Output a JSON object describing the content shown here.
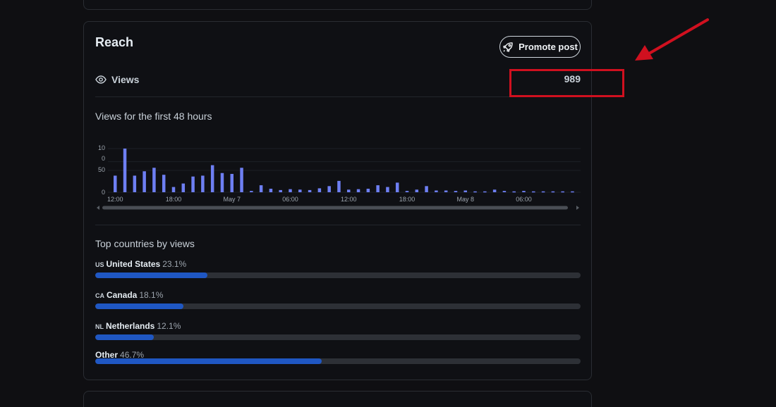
{
  "reach": {
    "title": "Reach",
    "promote_label": "Promote post",
    "views_label": "Views",
    "views_value": "989"
  },
  "chart_data": {
    "type": "bar",
    "title": "Views for the first 48 hours",
    "y_tick_labels": [
      "10\n0",
      "50",
      "0"
    ],
    "x_tick_labels": [
      "12:00",
      "18:00",
      "May 7",
      "06:00",
      "12:00",
      "18:00",
      "May 8",
      "06:00"
    ],
    "ylim": [
      0,
      100
    ],
    "values": [
      38,
      100,
      38,
      48,
      56,
      40,
      12,
      20,
      36,
      38,
      62,
      44,
      42,
      56,
      3,
      16,
      8,
      5,
      7,
      6,
      5,
      9,
      14,
      26,
      6,
      7,
      8,
      16,
      12,
      22,
      3,
      6,
      14,
      4,
      4,
      3,
      4,
      2,
      2,
      6,
      3,
      2,
      3,
      2,
      2,
      2,
      2,
      2
    ],
    "bar_color": "#6e7ff3",
    "grid": true
  },
  "countries": {
    "title": "Top countries by views",
    "items": [
      {
        "code": "US",
        "name": "United States",
        "pct_label": "23.1%",
        "fraction": 0.231
      },
      {
        "code": "CA",
        "name": "Canada",
        "pct_label": "18.1%",
        "fraction": 0.181
      },
      {
        "code": "NL",
        "name": "Netherlands",
        "pct_label": "12.1%",
        "fraction": 0.121
      },
      {
        "code": "",
        "name": "Other",
        "pct_label": "46.7%",
        "fraction": 0.467
      }
    ],
    "bar_color": "#1f57c3"
  },
  "annotation": {
    "color": "#d0101f"
  }
}
